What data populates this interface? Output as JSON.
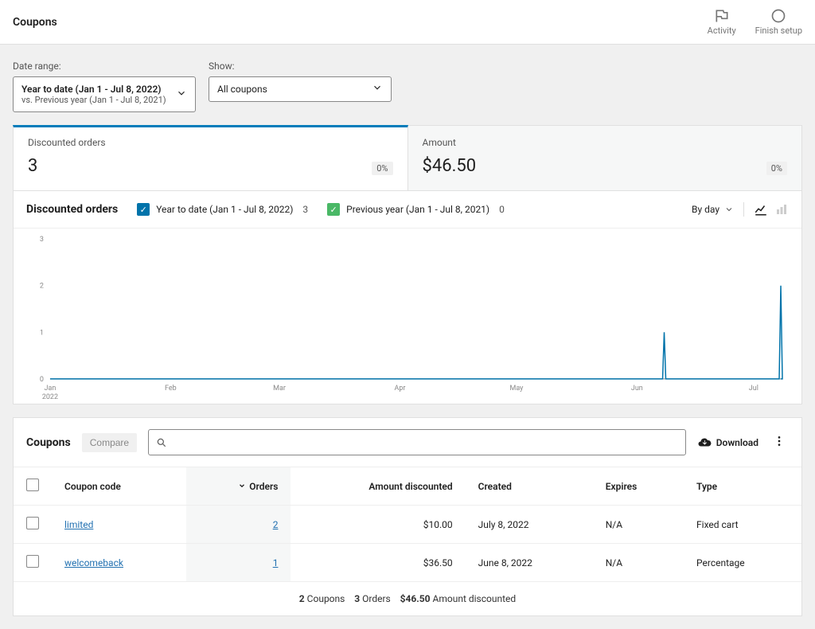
{
  "page_title": "Coupons",
  "topbar_actions": {
    "activity": "Activity",
    "finish_setup": "Finish setup"
  },
  "filters": {
    "date_label": "Date range:",
    "date_primary": "Year to date (Jan 1 - Jul 8, 2022)",
    "date_secondary": "vs. Previous year (Jan 1 - Jul 8, 2021)",
    "show_label": "Show:",
    "show_value": "All coupons"
  },
  "summary": {
    "discounted_orders": {
      "title": "Discounted orders",
      "value": "3",
      "pct": "0%"
    },
    "amount": {
      "title": "Amount",
      "value": "$46.50",
      "pct": "0%"
    }
  },
  "chart": {
    "title": "Discounted orders",
    "legend_current": "Year to date (Jan 1 - Jul 8, 2022)",
    "legend_current_count": "3",
    "legend_previous": "Previous year (Jan 1 - Jul 8, 2021)",
    "legend_previous_count": "0",
    "interval": "By day",
    "colors": {
      "current": "#0073aa",
      "previous": "#4ab866"
    }
  },
  "chart_data": {
    "type": "line",
    "title": "Discounted orders",
    "xlabel": "2022",
    "ylabel": "",
    "ylim": [
      0,
      3
    ],
    "x_ticks": [
      "Jan",
      "Feb",
      "Mar",
      "Apr",
      "May",
      "Jun",
      "Jul"
    ],
    "y_ticks": [
      0,
      1,
      2,
      3
    ],
    "series": [
      {
        "name": "Year to date (Jan 1 - Jul 8, 2022)",
        "points": [
          {
            "date": "2022-06-08",
            "value": 1
          },
          {
            "date": "2022-07-08",
            "value": 2
          }
        ],
        "baseline": 0
      },
      {
        "name": "Previous year (Jan 1 - Jul 8, 2021)",
        "points": [],
        "baseline": 0
      }
    ]
  },
  "table": {
    "title": "Coupons",
    "compare_label": "Compare",
    "download_label": "Download",
    "search_placeholder": "",
    "columns": {
      "code": "Coupon code",
      "orders": "Orders",
      "amount": "Amount discounted",
      "created": "Created",
      "expires": "Expires",
      "type": "Type"
    },
    "rows": [
      {
        "code": "limited",
        "orders": "2",
        "amount": "$10.00",
        "created": "July 8, 2022",
        "expires": "N/A",
        "type": "Fixed cart"
      },
      {
        "code": "welcomeback",
        "orders": "1",
        "amount": "$36.50",
        "created": "June 8, 2022",
        "expires": "N/A",
        "type": "Percentage"
      }
    ],
    "footer": {
      "coupons": "2",
      "coupons_label": "Coupons",
      "orders": "3",
      "orders_label": "Orders",
      "amount": "$46.50",
      "amount_label": "Amount discounted"
    }
  }
}
